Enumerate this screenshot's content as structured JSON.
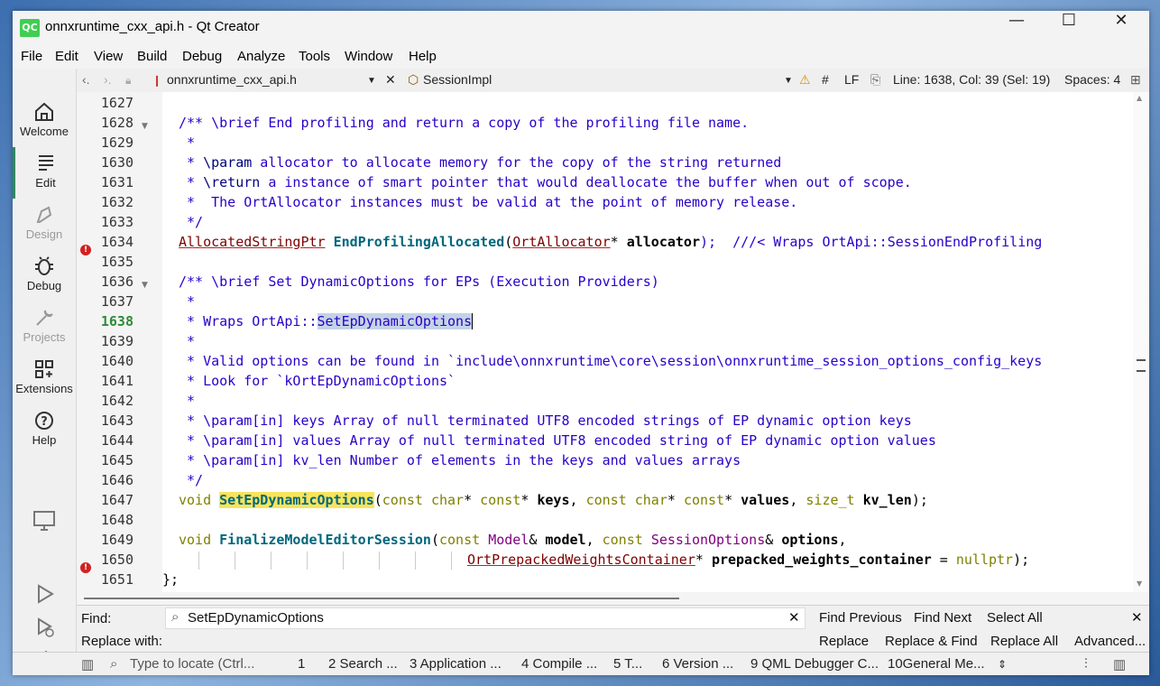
{
  "window": {
    "app_icon": "QC",
    "title": "onnxruntime_cxx_api.h - Qt Creator"
  },
  "menu": [
    "File",
    "Edit",
    "View",
    "Build",
    "Debug",
    "Analyze",
    "Tools",
    "Window",
    "Help"
  ],
  "modes": [
    {
      "label": "Welcome",
      "icon": "home-icon"
    },
    {
      "label": "Edit",
      "icon": "edit-icon"
    },
    {
      "label": "Design",
      "icon": "design-icon"
    },
    {
      "label": "Debug",
      "icon": "bug-icon"
    },
    {
      "label": "Projects",
      "icon": "wrench-icon"
    },
    {
      "label": "Extensions",
      "icon": "extensions-icon"
    },
    {
      "label": "Help",
      "icon": "help-icon"
    }
  ],
  "editor_toolbar": {
    "file": "onnxruntime_cxx_api.h",
    "symbol": "SessionImpl",
    "hash": "#",
    "line_ending": "LF",
    "position": "Line: 1638, Col: 39 (Sel: 19)",
    "spaces": "Spaces: 4"
  },
  "line_numbers": [
    "1627",
    "1628",
    "1629",
    "1630",
    "1631",
    "1632",
    "1633",
    "1634",
    "1635",
    "1636",
    "1637",
    "1638",
    "1639",
    "1640",
    "1641",
    "1642",
    "1643",
    "1644",
    "1645",
    "1646",
    "1647",
    "1648",
    "1649",
    "1650",
    "1651"
  ],
  "code": {
    "l1628": "/** \\brief End profiling and return a copy of the profiling file name.",
    "l1629": " *",
    "l1630a": " * ",
    "l1630b": "\\param",
    "l1630c": " allocator to allocate memory for the copy of the string returned",
    "l1631a": " * ",
    "l1631b": "\\return",
    "l1631c": " a instance of smart pointer that would deallocate the buffer when out of scope.",
    "l1632": " *  The OrtAllocator instances must be valid at the point of memory release.",
    "l1633": " */",
    "l1634a": "AllocatedStringPtr",
    "l1634b": "EndProfilingAllocated",
    "l1634c": "(",
    "l1634d": "OrtAllocator",
    "l1634e": "* ",
    "l1634f": "allocator",
    "l1634g": ");  ///< Wraps OrtApi::SessionEndProfiling",
    "l1636": "/** \\brief Set DynamicOptions for EPs (Execution Providers)",
    "l1637": " *",
    "l1638a": " * Wraps OrtApi::",
    "l1638b": "SetEpDynamicOptions",
    "l1639": " *",
    "l1640": " * Valid options can be found in `include\\onnxruntime\\core\\session\\onnxruntime_session_options_config_keys",
    "l1641": " * Look for `kOrtEpDynamicOptions`",
    "l1642": " *",
    "l1643": " * \\param[in] keys Array of null terminated UTF8 encoded strings of EP dynamic option keys",
    "l1644": " * \\param[in] values Array of null terminated UTF8 encoded string of EP dynamic option values",
    "l1645": " * \\param[in] kv_len Number of elements in the keys and values arrays",
    "l1646": " */",
    "l1647a": "void",
    "l1647b": "SetEpDynamicOptions",
    "l1647c": "(",
    "l1647d": "const char",
    "l1647e": "* ",
    "l1647f": "const",
    "l1647g": "* ",
    "l1647h": "keys",
    "l1647i": ", ",
    "l1647j": "const char",
    "l1647k": "* ",
    "l1647l": "const",
    "l1647m": "* ",
    "l1647n": "values",
    "l1647o": ", ",
    "l1647p": "size_t",
    "l1647q": " ",
    "l1647r": "kv_len",
    "l1647s": ");",
    "l1649a": "void",
    "l1649b": "FinalizeModelEditorSession",
    "l1649c": "(",
    "l1649d": "const",
    "l1649e": " ",
    "l1649f": "Model",
    "l1649g": "& ",
    "l1649h": "model",
    "l1649i": ", ",
    "l1649j": "const",
    "l1649k": " ",
    "l1649l": "SessionOptions",
    "l1649m": "& ",
    "l1649n": "options",
    "l1649o": ",",
    "l1650a": "OrtPrepackedWeightsContainer",
    "l1650b": "* ",
    "l1650c": "prepacked_weights_container",
    "l1650d": " = ",
    "l1650e": "nullptr",
    "l1650f": ");",
    "l1651": "};"
  },
  "find": {
    "find_label": "Find:",
    "find_value": "SetEpDynamicOptions",
    "replace_label": "Replace with:",
    "find_previous": "Find Previous",
    "find_next": "Find Next",
    "select_all": "Select All",
    "replace": "Replace",
    "replace_find": "Replace & Find",
    "replace_all": "Replace All",
    "advanced": "Advanced..."
  },
  "statusbar": {
    "locator_placeholder": "Type to locate (Ctrl...",
    "panes": [
      "1",
      "2  Search ...",
      "3  Application ...",
      "4  Compile ...",
      "5  T...",
      "6  Version ...",
      "9  QML Debugger C...",
      "10General Me..."
    ]
  }
}
